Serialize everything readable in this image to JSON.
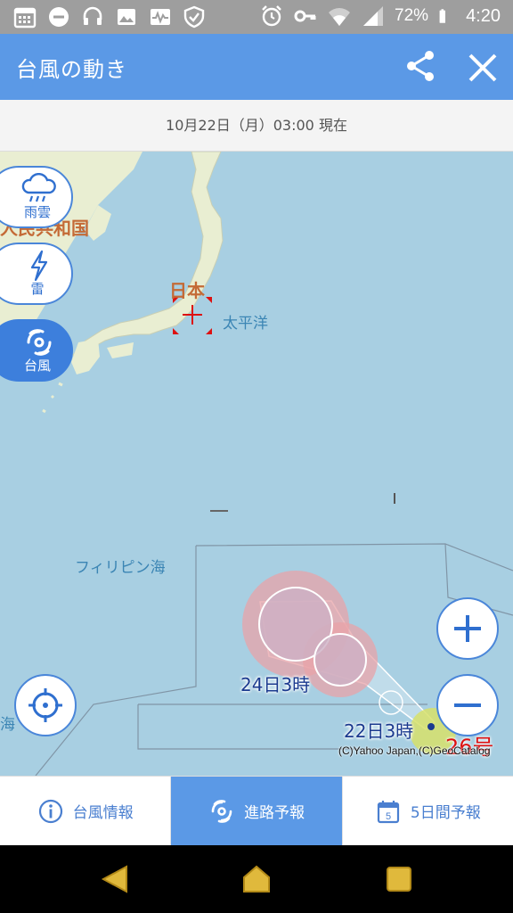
{
  "status_bar": {
    "battery": "72%",
    "time": "4:20",
    "icons": [
      "calendar-icon",
      "minus-circle-icon",
      "headset-icon",
      "image-icon",
      "activity-icon",
      "shield-check-icon",
      "alarm-icon",
      "key-icon",
      "wifi-icon",
      "signal-icon",
      "battery-icon"
    ]
  },
  "header": {
    "title": "台風の動き",
    "share_icon": "share-icon",
    "close_icon": "close-icon"
  },
  "timestamp": "10月22日（月）03:00 現在",
  "layers": {
    "rain": "雨雲",
    "thunder": "雷",
    "typhoon": "台風"
  },
  "map": {
    "labels": {
      "country_cut": "人民共和国",
      "japan": "日本",
      "pacific": "太平洋",
      "philippine_sea": "フィリピン海",
      "sea_edge": "海"
    },
    "track": {
      "point_22": "22日3時",
      "point_24": "24日3時",
      "typhoon_number": "26号"
    },
    "copyright": "(C)Yahoo Japan,(C)GeoCatalog",
    "colors": {
      "ocean": "#a8cfe2",
      "land": "#e9eed2",
      "storm_zone": "#e8a3a8",
      "accent": "#5b99e6"
    }
  },
  "tabs": [
    {
      "label": "台風情報",
      "icon": "info-icon"
    },
    {
      "label": "進路予報",
      "icon": "typhoon-icon"
    },
    {
      "label": "5日間予報",
      "icon": "calendar-5-icon",
      "calendar_day": "5"
    }
  ],
  "nav": [
    "back-icon",
    "home-icon",
    "recent-apps-icon"
  ]
}
